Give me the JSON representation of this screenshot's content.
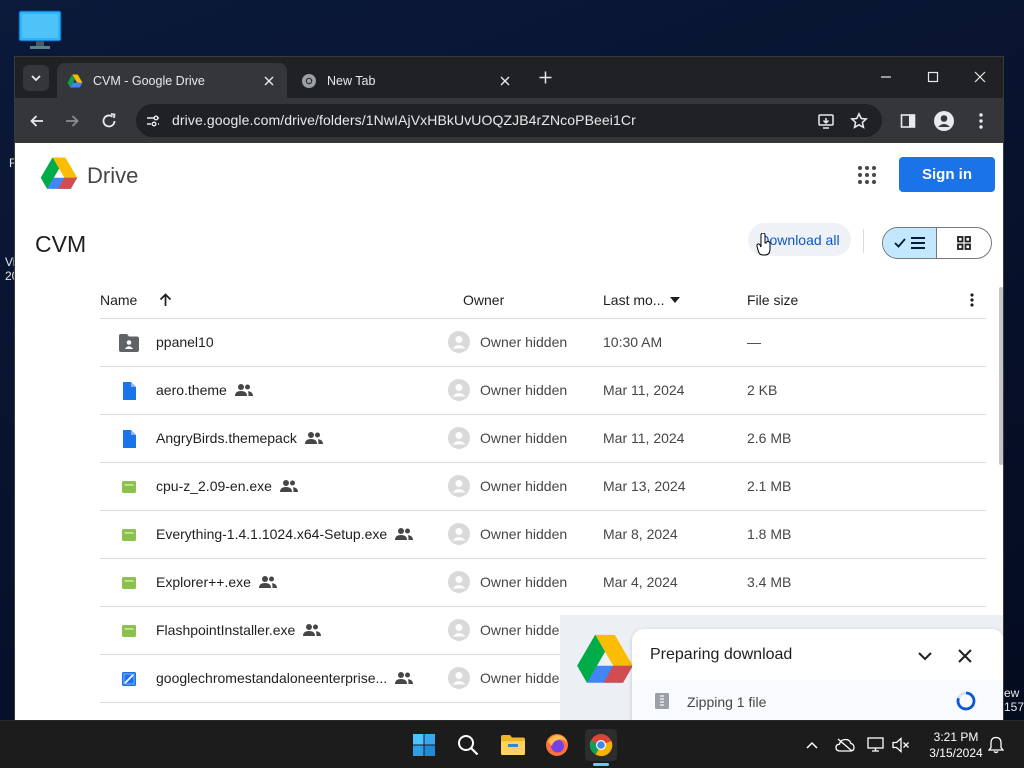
{
  "browser": {
    "tabs": [
      {
        "title": "CVM - Google Drive",
        "active": true
      },
      {
        "title": "New Tab",
        "active": false
      }
    ],
    "url": "drive.google.com/drive/folders/1NwIAjVxHBkUvUOQZJB4rZNcoPBeei1Cr"
  },
  "drive": {
    "brand": "Drive",
    "sign_in": "Sign in",
    "folder_title": "CVM",
    "download_all": "Download all",
    "columns": {
      "name": "Name",
      "owner": "Owner",
      "modified": "Last mo...",
      "size": "File size"
    },
    "files": [
      {
        "name": "ppanel10",
        "type": "shared-folder",
        "shared": false,
        "owner": "Owner hidden",
        "modified": "10:30 AM",
        "size": "—"
      },
      {
        "name": "aero.theme",
        "type": "doc",
        "shared": true,
        "owner": "Owner hidden",
        "modified": "Mar 11, 2024",
        "size": "2 KB"
      },
      {
        "name": "AngryBirds.themepack",
        "type": "doc",
        "shared": true,
        "owner": "Owner hidden",
        "modified": "Mar 11, 2024",
        "size": "2.6 MB"
      },
      {
        "name": "cpu-z_2.09-en.exe",
        "type": "exe",
        "shared": true,
        "owner": "Owner hidden",
        "modified": "Mar 13, 2024",
        "size": "2.1 MB"
      },
      {
        "name": "Everything-1.4.1.1024.x64-Setup.exe",
        "type": "exe",
        "shared": true,
        "owner": "Owner hidden",
        "modified": "Mar 8, 2024",
        "size": "1.8 MB"
      },
      {
        "name": "Explorer++.exe",
        "type": "exe",
        "shared": true,
        "owner": "Owner hidden",
        "modified": "Mar 4, 2024",
        "size": "3.4 MB"
      },
      {
        "name": "FlashpointInstaller.exe",
        "type": "exe",
        "shared": true,
        "owner": "Owner hidde",
        "modified": "",
        "size": ""
      },
      {
        "name": "googlechromestandaloneenterprise...",
        "type": "msi",
        "shared": true,
        "owner": "Owner hidde",
        "modified": "",
        "size": ""
      }
    ],
    "download_panel": {
      "title": "Preparing download",
      "item": "Zipping 1 file"
    }
  },
  "taskbar": {
    "time": "3:21 PM",
    "date": "3/15/2024"
  },
  "desktop": {
    "fragments": [
      "R",
      "Vi",
      "20",
      "ew",
      "157"
    ]
  },
  "colors": {
    "accent": "#1a73e8",
    "toggle_on": "#c2e7ff",
    "exe_icon": "#8bc34a",
    "doc_icon": "#1a73e8"
  }
}
